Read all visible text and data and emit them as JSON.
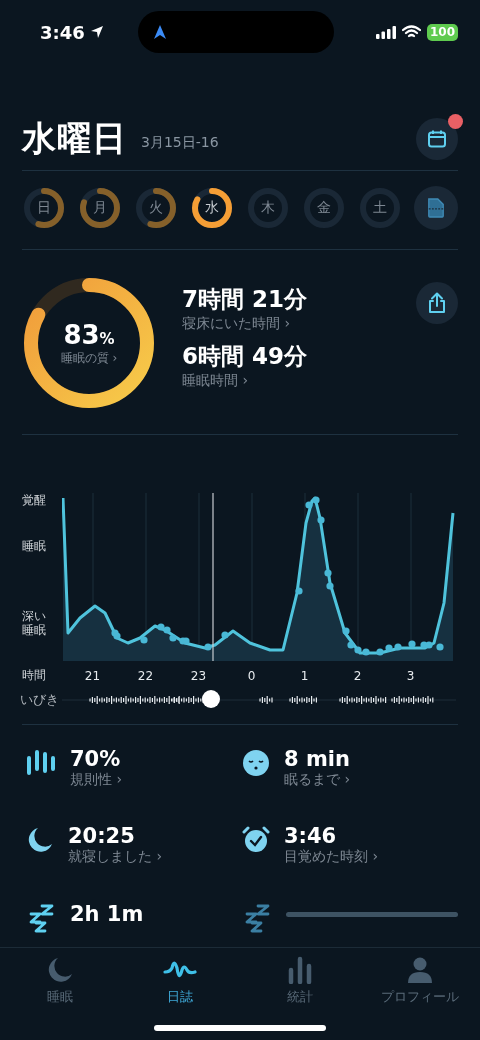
{
  "status_bar": {
    "time": "3:46",
    "battery": "100"
  },
  "header": {
    "title": "水曜日",
    "date_range": "3月15日-16",
    "calendar_has_notification": true
  },
  "days": [
    {
      "label": "日",
      "selected": false
    },
    {
      "label": "月",
      "selected": false
    },
    {
      "label": "火",
      "selected": false
    },
    {
      "label": "水",
      "selected": true
    },
    {
      "label": "木",
      "selected": false
    },
    {
      "label": "金",
      "selected": false
    },
    {
      "label": "土",
      "selected": false
    }
  ],
  "summary": {
    "quality": {
      "value": "83",
      "unit": "%",
      "label": "睡眠の質 ›"
    },
    "stats": [
      {
        "value": "7時間 21分",
        "label": "寝床にいた時間 ›"
      },
      {
        "value": "6時間 49分",
        "label": "睡眠時間 ›"
      }
    ]
  },
  "sleep_graph": {
    "y_labels": [
      "覚醒",
      "睡眠",
      "深い睡眠"
    ],
    "x_title": "時間",
    "x_labels": [
      "21",
      "22",
      "23",
      "0",
      "1",
      "2",
      "3"
    ],
    "snore_label": "いびき"
  },
  "metrics": [
    {
      "kind": "stat",
      "value": "70%",
      "label": "規則性 ›"
    },
    {
      "kind": "stat",
      "value": "8 min",
      "label": "眠るまで ›"
    },
    {
      "kind": "stat",
      "value": "20:25",
      "label": "就寝しました ›"
    },
    {
      "kind": "stat",
      "value": "3:46",
      "label": "目覚めた時刻 ›"
    },
    {
      "kind": "stat",
      "value": "2h  1m"
    },
    {
      "kind": "loading"
    }
  ],
  "tabs": [
    {
      "label": "睡眠",
      "selected": false
    },
    {
      "label": "日誌",
      "selected": true
    },
    {
      "label": "統計",
      "selected": false
    },
    {
      "label": "プロフィール",
      "selected": false
    }
  ]
}
